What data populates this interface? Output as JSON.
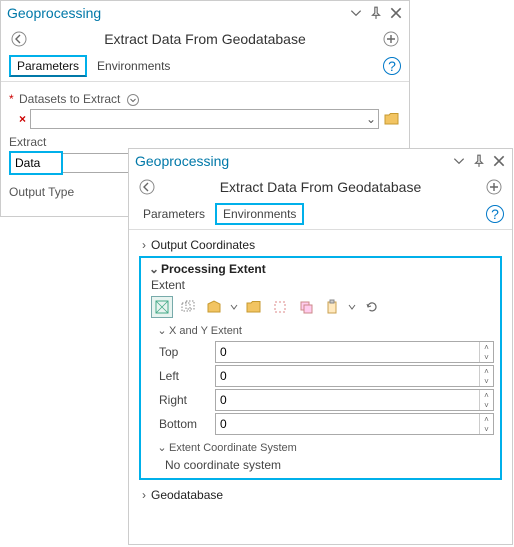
{
  "panelBack": {
    "title": "Geoprocessing",
    "headerTitle": "Extract Data From Geodatabase",
    "tabs": {
      "params": "Parameters",
      "env": "Environments"
    },
    "datasetsLabel": "Datasets to Extract",
    "extractLabel": "Extract",
    "extractValue": "Data",
    "outputTypeLabel": "Output Type"
  },
  "panelFront": {
    "title": "Geoprocessing",
    "headerTitle": "Extract Data From Geodatabase",
    "tabs": {
      "params": "Parameters",
      "env": "Environments"
    },
    "sections": {
      "outputCoords": "Output Coordinates",
      "procExtent": "Processing Extent",
      "geodatabase": "Geodatabase"
    },
    "extentLabel": "Extent",
    "xyExtentLabel": "X and Y Extent",
    "fields": {
      "top": {
        "label": "Top",
        "value": "0"
      },
      "left": {
        "label": "Left",
        "value": "0"
      },
      "right": {
        "label": "Right",
        "value": "0"
      },
      "bottom": {
        "label": "Bottom",
        "value": "0"
      }
    },
    "extentCoordLabel": "Extent Coordinate System",
    "noCoordText": "No coordinate system"
  }
}
